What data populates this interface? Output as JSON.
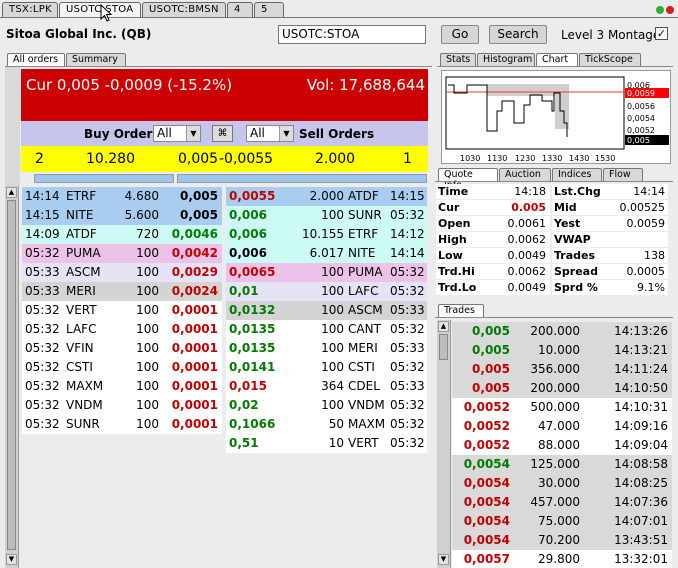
{
  "tabs": [
    "TSX:LPK",
    "USOTC:STOA",
    "USOTC:BMSN",
    "4",
    "5"
  ],
  "company": "Sitoa Global Inc. (QB)",
  "symbol_input": "USOTC:STOA",
  "go_label": "Go",
  "search_label": "Search",
  "level3_label": "Level 3 Montage",
  "level3_checked": true,
  "left_tabs": [
    "All orders",
    "Summary"
  ],
  "header": {
    "cur": "Cur 0,005 -0,0009 (-15.2%)",
    "vol": "Vol: 17,688,644"
  },
  "buy_orders_label": "Buy Orders",
  "sell_orders_label": "Sell Orders",
  "buy_filter": "All",
  "sell_filter": "All",
  "summary": {
    "buy_count": "2",
    "buy_size": "10.280",
    "bid": "0,005",
    "ask": "-0,0055",
    "sell_size": "2.000",
    "sell_count": "1"
  },
  "buy_orders": [
    {
      "time": "14:14",
      "mm": "ETRF",
      "size": "4.680",
      "price": "0,005",
      "color": "#a9cdf1"
    },
    {
      "time": "14:15",
      "mm": "NITE",
      "size": "5.600",
      "price": "0,005",
      "color": "#a9cdf1"
    },
    {
      "time": "14:09",
      "mm": "ATDF",
      "size": "720",
      "price": "0,0046",
      "color": "#ccfbf5"
    },
    {
      "time": "05:32",
      "mm": "PUMA",
      "size": "100",
      "price": "0,0042",
      "color": "#ecc2e8"
    },
    {
      "time": "05:33",
      "mm": "ASCM",
      "size": "100",
      "price": "0,0029",
      "color": "#e4e4f6"
    },
    {
      "time": "05:33",
      "mm": "MERI",
      "size": "100",
      "price": "0,0024",
      "color": "#d4d4d4"
    },
    {
      "time": "05:32",
      "mm": "VERT",
      "size": "100",
      "price": "0,0001",
      "color": "#ffffff"
    },
    {
      "time": "05:32",
      "mm": "LAFC",
      "size": "100",
      "price": "0,0001",
      "color": "#ffffff"
    },
    {
      "time": "05:32",
      "mm": "VFIN",
      "size": "100",
      "price": "0,0001",
      "color": "#ffffff"
    },
    {
      "time": "05:32",
      "mm": "CSTI",
      "size": "100",
      "price": "0,0001",
      "color": "#ffffff"
    },
    {
      "time": "05:32",
      "mm": "MAXM",
      "size": "100",
      "price": "0,0001",
      "color": "#ffffff"
    },
    {
      "time": "05:32",
      "mm": "VNDM",
      "size": "100",
      "price": "0,0001",
      "color": "#ffffff"
    },
    {
      "time": "05:32",
      "mm": "SUNR",
      "size": "100",
      "price": "0,0001",
      "color": "#ffffff"
    }
  ],
  "sell_orders": [
    {
      "price": "0,0055",
      "size": "2.000",
      "mm": "ATDF",
      "time": "14:15",
      "color": "#a9cdf1",
      "pc": "red"
    },
    {
      "price": "0,006",
      "size": "100",
      "mm": "SUNR",
      "time": "05:32",
      "color": "#ccfbf5",
      "pc": "green"
    },
    {
      "price": "0,006",
      "size": "10.155",
      "mm": "ETRF",
      "time": "14:12",
      "color": "#ccfbf5",
      "pc": "green"
    },
    {
      "price": "0,006",
      "size": "6.017",
      "mm": "NITE",
      "time": "14:14",
      "color": "#ccfbf5",
      "pc": "black"
    },
    {
      "price": "0,0065",
      "size": "100",
      "mm": "PUMA",
      "time": "05:32",
      "color": "#ecc2e8",
      "pc": "red"
    },
    {
      "price": "0,01",
      "size": "100",
      "mm": "LAFC",
      "time": "05:32",
      "color": "#e4e4f6",
      "pc": "green"
    },
    {
      "price": "0,0132",
      "size": "100",
      "mm": "ASCM",
      "time": "05:33",
      "color": "#d4d4d4",
      "pc": "green"
    },
    {
      "price": "0,0135",
      "size": "100",
      "mm": "CANT",
      "time": "05:32",
      "color": "#ffffff",
      "pc": "green"
    },
    {
      "price": "0,0135",
      "size": "100",
      "mm": "MERI",
      "time": "05:33",
      "color": "#ffffff",
      "pc": "green"
    },
    {
      "price": "0,0141",
      "size": "100",
      "mm": "CSTI",
      "time": "05:32",
      "color": "#ffffff",
      "pc": "green"
    },
    {
      "price": "0,015",
      "size": "364",
      "mm": "CDEL",
      "time": "05:33",
      "color": "#ffffff",
      "pc": "red"
    },
    {
      "price": "0,02",
      "size": "100",
      "mm": "VNDM",
      "time": "05:32",
      "color": "#ffffff",
      "pc": "green"
    },
    {
      "price": "0,1066",
      "size": "50",
      "mm": "MAXM",
      "time": "05:32",
      "color": "#ffffff",
      "pc": "green"
    },
    {
      "price": "0,51",
      "size": "10",
      "mm": "VERT",
      "time": "05:32",
      "color": "#ffffff",
      "pc": "green"
    }
  ],
  "right_tabs": [
    "Stats",
    "Histogram",
    "Chart",
    "TickScope"
  ],
  "chart": {
    "x_labels": [
      "1030",
      "1130",
      "1230",
      "1330",
      "1430",
      "1530"
    ],
    "y_labels": [
      "0,006",
      "0,0059",
      "0,0056",
      "0,0054",
      "0,0052",
      "0,005"
    ]
  },
  "quote_tabs": [
    "Quote Info",
    "Auction",
    "Indices",
    "Flow"
  ],
  "quote": [
    {
      "l1": "Time",
      "v1": "14:18",
      "l2": "Lst.Chg",
      "v2": "14:14",
      "v1red": false
    },
    {
      "l1": "Cur",
      "v1": "0.005",
      "l2": "Mid",
      "v2": "0.00525",
      "v1red": true
    },
    {
      "l1": "Open",
      "v1": "0.0061",
      "l2": "Yest",
      "v2": "0.0059",
      "v1red": false
    },
    {
      "l1": "High",
      "v1": "0.0062",
      "l2": "VWAP",
      "v2": "",
      "v1red": false
    },
    {
      "l1": "Low",
      "v1": "0.0049",
      "l2": "Trades",
      "v2": "138",
      "v1red": false
    },
    {
      "l1": "Trd.Hi",
      "v1": "0.0062",
      "l2": "Spread",
      "v2": "0.0005",
      "v1red": false
    },
    {
      "l1": "Trd.Lo",
      "v1": "0.0049",
      "l2": "Sprd %",
      "v2": "9.1%",
      "v1red": false
    }
  ],
  "trades_tab": "Trades",
  "trades": [
    {
      "price": "0,005",
      "size": "200.000",
      "time": "14:13:26",
      "pc": "green",
      "bg": "#d9d9d9"
    },
    {
      "price": "0,005",
      "size": "10.000",
      "time": "14:13:21",
      "pc": "green",
      "bg": "#d9d9d9"
    },
    {
      "price": "0,005",
      "size": "356.000",
      "time": "14:11:24",
      "pc": "red",
      "bg": "#d9d9d9"
    },
    {
      "price": "0,005",
      "size": "200.000",
      "time": "14:10:50",
      "pc": "red",
      "bg": "#d9d9d9"
    },
    {
      "price": "0,0052",
      "size": "500.000",
      "time": "14:10:31",
      "pc": "red",
      "bg": "#ffffff"
    },
    {
      "price": "0,0052",
      "size": "47.000",
      "time": "14:09:16",
      "pc": "red",
      "bg": "#ffffff"
    },
    {
      "price": "0,0052",
      "size": "88.000",
      "time": "14:09:04",
      "pc": "red",
      "bg": "#ffffff"
    },
    {
      "price": "0,0054",
      "size": "125.000",
      "time": "14:08:58",
      "pc": "green",
      "bg": "#d9d9d9"
    },
    {
      "price": "0,0054",
      "size": "30.000",
      "time": "14:08:25",
      "pc": "red",
      "bg": "#d9d9d9"
    },
    {
      "price": "0,0054",
      "size": "457.000",
      "time": "14:07:36",
      "pc": "red",
      "bg": "#d9d9d9"
    },
    {
      "price": "0,0054",
      "size": "75.000",
      "time": "14:07:01",
      "pc": "red",
      "bg": "#d9d9d9"
    },
    {
      "price": "0,0054",
      "size": "70.200",
      "time": "13:43:51",
      "pc": "red",
      "bg": "#d9d9d9"
    },
    {
      "price": "0,0057",
      "size": "29.800",
      "time": "13:32:01",
      "pc": "red",
      "bg": "#ffffff"
    }
  ],
  "colors": {
    "header_red": "#cc0000",
    "filter_blue": "#c6c6ec",
    "summary_yellow": "#ffff00"
  }
}
